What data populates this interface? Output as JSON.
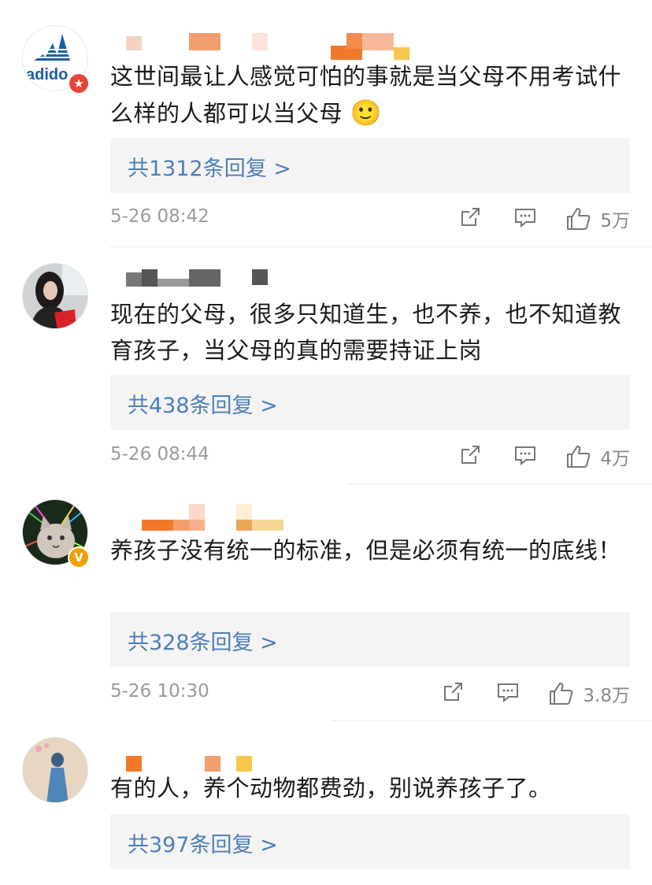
{
  "comments": [
    {
      "text": "这世间最让人感觉可怕的事就是当父母不用考试什么样的人都可以当父母",
      "emoji": "🙂",
      "replies": "共1312条回复 >",
      "time": "5-26 08:42",
      "likes": "5万",
      "avatar_icon": "adidas-logo",
      "badge": "red-star-badge"
    },
    {
      "text": "现在的父母，很多只知道生，也不养，也不知道教育孩子，当父母的真的需要持证上岗",
      "replies": "共438条回复 >",
      "time": "5-26 08:44",
      "likes": "4万",
      "avatar_icon": "girl-photo"
    },
    {
      "text": "养孩子没有统一的标准，但是必须有统一的底线！",
      "replies": "共328条回复 >",
      "time": "5-26 10:30",
      "likes": "3.8万",
      "avatar_icon": "cat-photo",
      "badge": "orange-v-badge"
    },
    {
      "text": "有的人，养个动物都费劲，别说养孩子了。",
      "replies": "共397条回复 >",
      "avatar_icon": "blue-figure-photo"
    }
  ],
  "colors": {
    "link": "#4d7fb8",
    "reply_bg": "#f4f4f4",
    "meta": "#9b9b9b",
    "mosaic_orange": "#f07a2a",
    "mosaic_gray": "#555555"
  },
  "badge_text": {
    "star": "★",
    "v": "V"
  }
}
